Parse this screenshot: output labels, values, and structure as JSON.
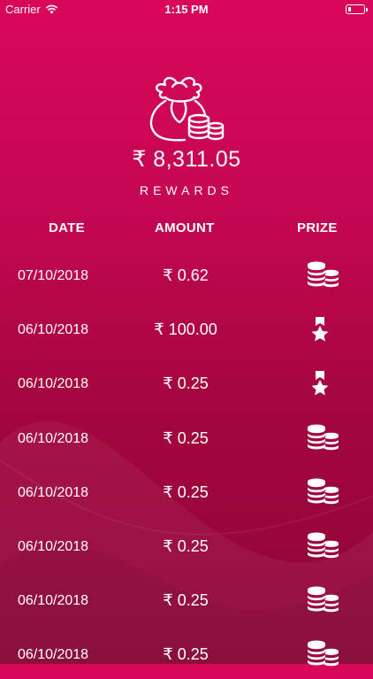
{
  "status_bar": {
    "carrier": "Carrier",
    "time": "1:15 PM",
    "battery_level": 0.15
  },
  "summary": {
    "total": "₹ 8,311.05",
    "label": "REWARDS"
  },
  "table": {
    "headers": {
      "date": "DATE",
      "amount": "AMOUNT",
      "prize": "PRIZE"
    },
    "rows": [
      {
        "date": "07/10/2018",
        "amount": "₹ 0.62",
        "prize_icon": "coins-icon"
      },
      {
        "date": "06/10/2018",
        "amount": "₹ 100.00",
        "prize_icon": "medal-icon"
      },
      {
        "date": "06/10/2018",
        "amount": "₹ 0.25",
        "prize_icon": "medal-icon"
      },
      {
        "date": "06/10/2018",
        "amount": "₹ 0.25",
        "prize_icon": "coins-icon"
      },
      {
        "date": "06/10/2018",
        "amount": "₹ 0.25",
        "prize_icon": "coins-icon"
      },
      {
        "date": "06/10/2018",
        "amount": "₹ 0.25",
        "prize_icon": "coins-icon"
      },
      {
        "date": "06/10/2018",
        "amount": "₹ 0.25",
        "prize_icon": "coins-icon"
      },
      {
        "date": "06/10/2018",
        "amount": "₹ 0.25",
        "prize_icon": "coins-icon"
      }
    ]
  },
  "colors": {
    "gradient_top": "#d8075a",
    "gradient_bottom": "#8d0636",
    "text": "#ffffff"
  },
  "icons": {
    "header": "money-bag-with-coins-icon",
    "wifi": "wifi-icon",
    "battery": "battery-icon"
  }
}
